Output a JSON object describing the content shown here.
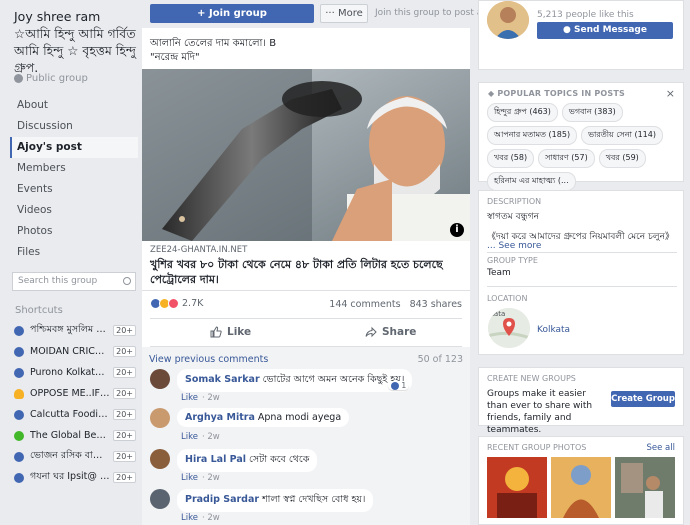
{
  "group": {
    "title": "Joy shree ram ☆আমি হিন্দু আমি গর্বিত আমি হিন্দু ☆ বৃহত্তম হিন্দু গ্রুপ.",
    "privacy": "Public group"
  },
  "nav": [
    {
      "label": "About"
    },
    {
      "label": "Discussion"
    },
    {
      "label": "Ajoy's post"
    },
    {
      "label": "Members"
    },
    {
      "label": "Events"
    },
    {
      "label": "Videos"
    },
    {
      "label": "Photos"
    },
    {
      "label": "Files"
    }
  ],
  "search": {
    "placeholder": "Search this group"
  },
  "shortcuts": {
    "heading": "Shortcuts",
    "items": [
      {
        "label": "পশ্চিমবঙ্গ মুসলিম বুদ্ধি...",
        "badge": "20+",
        "icon": "group-icon"
      },
      {
        "label": "MOIDAN CRICKET...",
        "badge": "20+",
        "icon": "group-icon"
      },
      {
        "label": "Purono Kolkatar G...",
        "badge": "20+",
        "icon": "group-icon"
      },
      {
        "label": "OPPOSE ME..IF U...",
        "badge": "20+",
        "icon": "bulb-icon"
      },
      {
        "label": "Calcutta Foodies C...",
        "badge": "20+",
        "icon": "group-icon"
      },
      {
        "label": "The Global Bengali",
        "badge": "20+",
        "icon": "globe-icon"
      },
      {
        "label": "ভোজন রসিক বাঙালি -...",
        "badge": "20+",
        "icon": "group-icon"
      },
      {
        "label": "গযনা ঘর Ipsit@ The...",
        "badge": "20+",
        "icon": "group-icon"
      }
    ]
  },
  "topbar": {
    "join_label": "+ Join group",
    "more_label": "··· More",
    "hint": "Join this group to post and comment."
  },
  "post": {
    "text_line1": "আলানি তেলের দাম কমালো। B",
    "text_line2": "\"নরেন্দ্র মদি\"",
    "link_source": "ZEE24-GHANTA.IN.NET",
    "link_title": "খুশির খবর ৮০ টাকা থেকে নেমে ৪৮ টাকা প্রতি লিটার হতে চলেছে পেট্রোলের দাম।",
    "reaction_count": "2.7K",
    "comments_count": "144 comments",
    "shares_count": "843 shares",
    "like_label": "Like",
    "share_label": "Share"
  },
  "comments": {
    "view_previous": "View previous comments",
    "counter": "50 of 123",
    "items": [
      {
        "name": "Somak Sarkar",
        "text": "ভোটের আগে অমন অনেক কিছুই হয়।",
        "like": "Like",
        "time": "2w",
        "reactions": "1"
      },
      {
        "name": "Arghya Mitra",
        "text": "Apna modi ayega",
        "like": "Like",
        "time": "2w"
      },
      {
        "name": "Hira Lal Pal",
        "text": "সেটা কবে থেকে",
        "like": "Like",
        "time": "2w"
      },
      {
        "name": "Pradip Sardar",
        "text": "শালা স্বপ্ন দেখছিস বোধ হয়।",
        "like": "Like",
        "time": "2w"
      }
    ]
  },
  "admin": {
    "likes_text": "5,213 people like this",
    "send_message_label": "Send Message"
  },
  "topics": {
    "heading": "POPULAR TOPICS IN POSTS",
    "close_label": "×",
    "tags": [
      {
        "label": "হিন্দুর গ্রুপ (463)"
      },
      {
        "label": "ভগবান (383)"
      },
      {
        "label": "আপনার মতামত (185)"
      },
      {
        "label": "ভারতীয় সেনা (114)"
      },
      {
        "label": "খবর (58)"
      },
      {
        "label": "সাধারণ (57)"
      },
      {
        "label": "খবর (59)"
      },
      {
        "label": "হরিনাম এর মাহাত্ম্য (..."
      }
    ]
  },
  "about": {
    "description_heading": "DESCRIPTION",
    "description_text": "স্বাগতম বন্ধুগন",
    "description_more": "《দয়া করে আমাদের গ্রুপের নিয়মাবলী মেনে চলুন》",
    "see_more": "... See more",
    "type_heading": "GROUP TYPE",
    "type_value": "Team",
    "location_heading": "LOCATION",
    "location_value": "Kolkata",
    "map_label": "kata"
  },
  "create_group": {
    "heading": "CREATE NEW GROUPS",
    "desc": "Groups make it easier than ever to share with friends, family and teammates.",
    "button_label": "Create Group"
  },
  "photos": {
    "heading": "RECENT GROUP PHOTOS",
    "see_all": "See all"
  },
  "colors": {
    "brand": "#4267b2",
    "link": "#385898",
    "page_bg": "#e9ebee"
  }
}
